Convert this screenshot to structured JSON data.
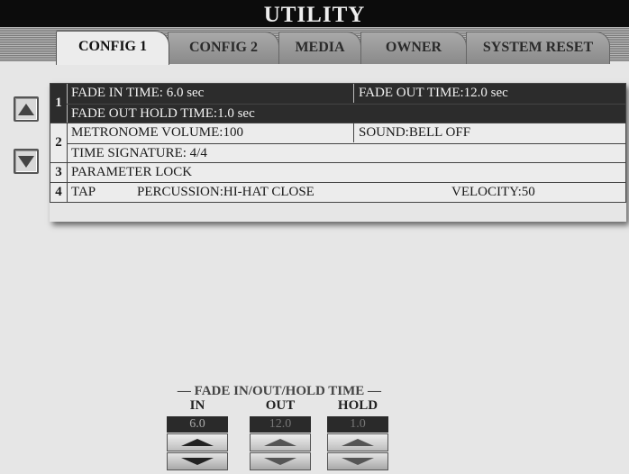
{
  "title": "UTILITY",
  "tabs": [
    {
      "label": "CONFIG 1",
      "active": true
    },
    {
      "label": "CONFIG 2",
      "active": false
    },
    {
      "label": "MEDIA",
      "active": false
    },
    {
      "label": "OWNER",
      "active": false
    },
    {
      "label": "SYSTEM RESET",
      "active": false
    }
  ],
  "groups": [
    {
      "number": "1",
      "row1_left": "FADE IN TIME:  6.0 sec",
      "row1_right": "FADE OUT TIME:12.0 sec",
      "row2": "FADE OUT HOLD TIME:1.0 sec"
    },
    {
      "number": "2",
      "row1_left": "METRONOME VOLUME:100",
      "row1_right": "SOUND:BELL OFF",
      "row2": "TIME SIGNATURE:   4/4"
    },
    {
      "number": "3",
      "row1": "PARAMETER LOCK"
    },
    {
      "number": "4",
      "row1": "TAP",
      "percussion": "PERCUSSION:HI-HAT CLOSE",
      "velocity": "VELOCITY:50"
    }
  ],
  "fade_panel": {
    "title": "— FADE IN/OUT/HOLD TIME —",
    "controls": [
      {
        "label": "IN",
        "value": "6.0"
      },
      {
        "label": "OUT",
        "value": "12.0"
      },
      {
        "label": "HOLD",
        "value": "1.0"
      }
    ]
  },
  "icons": {
    "scroll_up": "triangle-up-icon",
    "scroll_down": "triangle-down-icon"
  }
}
